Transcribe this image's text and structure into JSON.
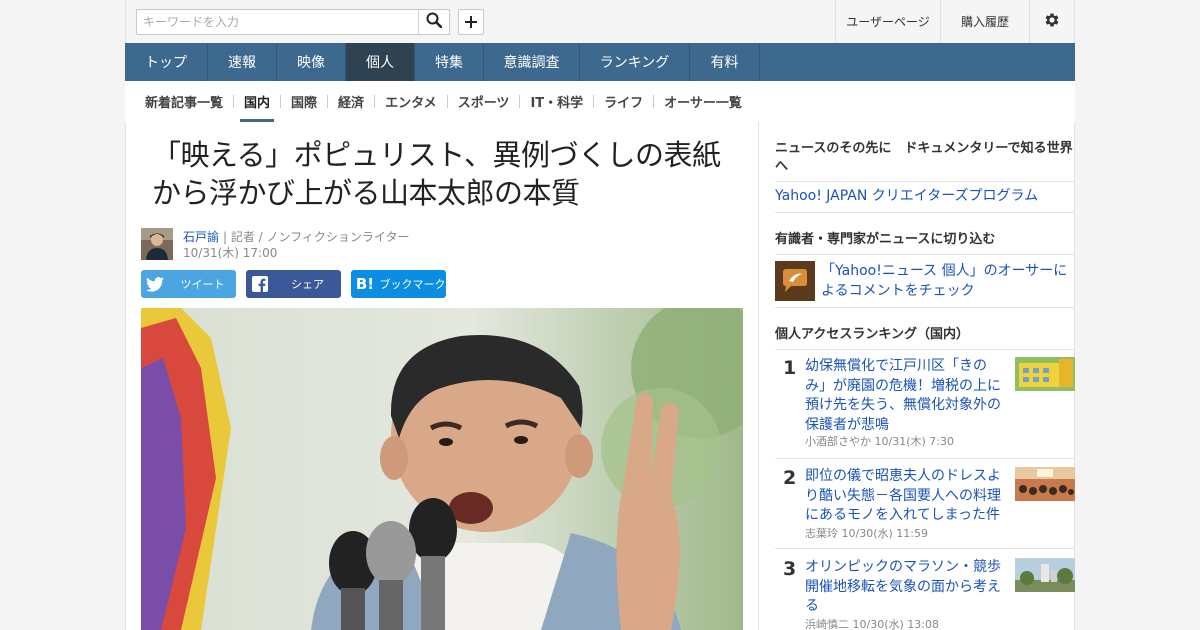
{
  "search": {
    "placeholder": "キーワードを入力"
  },
  "top_links": {
    "user_page": "ユーザーページ",
    "purchase_history": "購入履歴"
  },
  "main_nav": [
    "トップ",
    "速報",
    "映像",
    "個人",
    "特集",
    "意識調査",
    "ランキング",
    "有料"
  ],
  "main_nav_active": "個人",
  "sub_nav": [
    "新着記事一覧",
    "国内",
    "国際",
    "経済",
    "エンタメ",
    "スポーツ",
    "IT・科学",
    "ライフ",
    "オーサー一覧"
  ],
  "sub_nav_active": "国内",
  "article": {
    "headline": "「映える」ポピュリスト、異例づくしの表紙から浮かび上がる山本太郎の本質",
    "author_name": "石戸諭",
    "author_role": "| 記者 / ノンフィクションライター",
    "time": "10/31(木) 17:00"
  },
  "share": {
    "tweet": "ツイート",
    "facebook": "シェア",
    "hatena": "ブックマーク"
  },
  "sidebar": {
    "docs_heading": "ニュースのその先に　ドキュメンタリーで知る世界へ",
    "docs_link": "Yahoo! JAPAN クリエイターズプログラム",
    "expert_heading": "有識者・専門家がニュースに切り込む",
    "expert_link": "「Yahoo!ニュース 個人」のオーサーによるコメントをチェック",
    "ranking_heading": "個人アクセスランキング（国内）",
    "ranking": [
      {
        "rank": "1",
        "title": "幼保無償化で江戸川区「きのみ」が廃園の危機！増税の上に預け先を失う、無償化対象外の保護者が悲鳴",
        "author": "小酒部さやか",
        "time": "10/31(木) 7:30"
      },
      {
        "rank": "2",
        "title": "即位の儀で昭恵夫人のドレスより酷い失態－各国要人への料理にあるモノを入れてしまった件",
        "author": "志葉玲",
        "time": "10/30(水) 11:59"
      },
      {
        "rank": "3",
        "title": "オリンピックのマラソン・競歩　開催地移転を気象の面から考える",
        "author": "浜崎慎二",
        "time": "10/30(水) 13:08"
      }
    ]
  },
  "colors": {
    "nav_bg": "#3d698e",
    "nav_active": "#2f4252",
    "link": "#1a53b8",
    "twitter": "#4ba5e3",
    "facebook": "#3b5898",
    "hatena": "#0b8de1"
  }
}
